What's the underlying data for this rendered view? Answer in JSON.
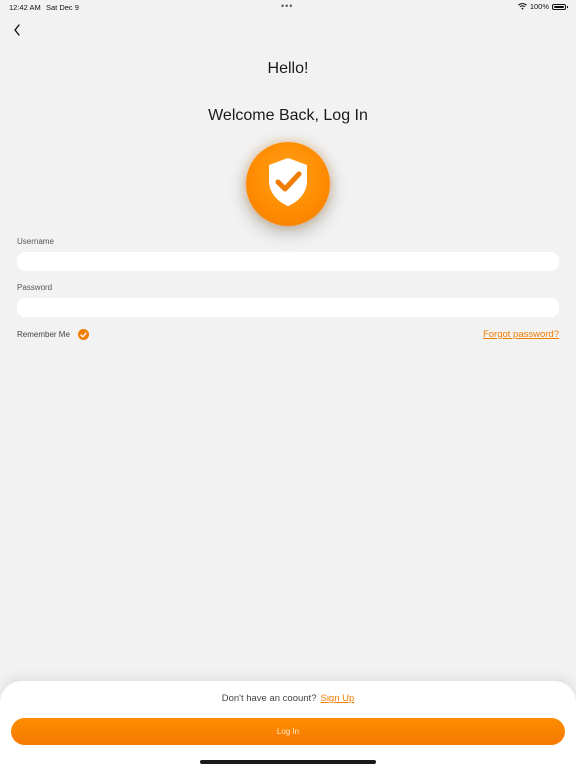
{
  "status_bar": {
    "time": "12:42 AM",
    "date": "Sat Dec 9",
    "battery": "100%",
    "dots": "•••"
  },
  "header": {
    "hello": "Hello!",
    "welcome": "Welcome Back, Log In"
  },
  "form": {
    "username_label": "Username",
    "username_value": "",
    "password_label": "Password",
    "password_value": "",
    "remember_label": "Remember Me",
    "remember_checked": true,
    "forgot_label": "Forgot password?"
  },
  "footer": {
    "no_account_text": "Don't have an coount?",
    "signup_label": "Sign Up",
    "login_label": "Log In"
  },
  "colors": {
    "accent": "#f07d00",
    "background": "#f2f2f2"
  },
  "icons": {
    "back": "chevron-left-icon",
    "badge": "shield-check-icon",
    "remember": "checkmark-icon"
  }
}
